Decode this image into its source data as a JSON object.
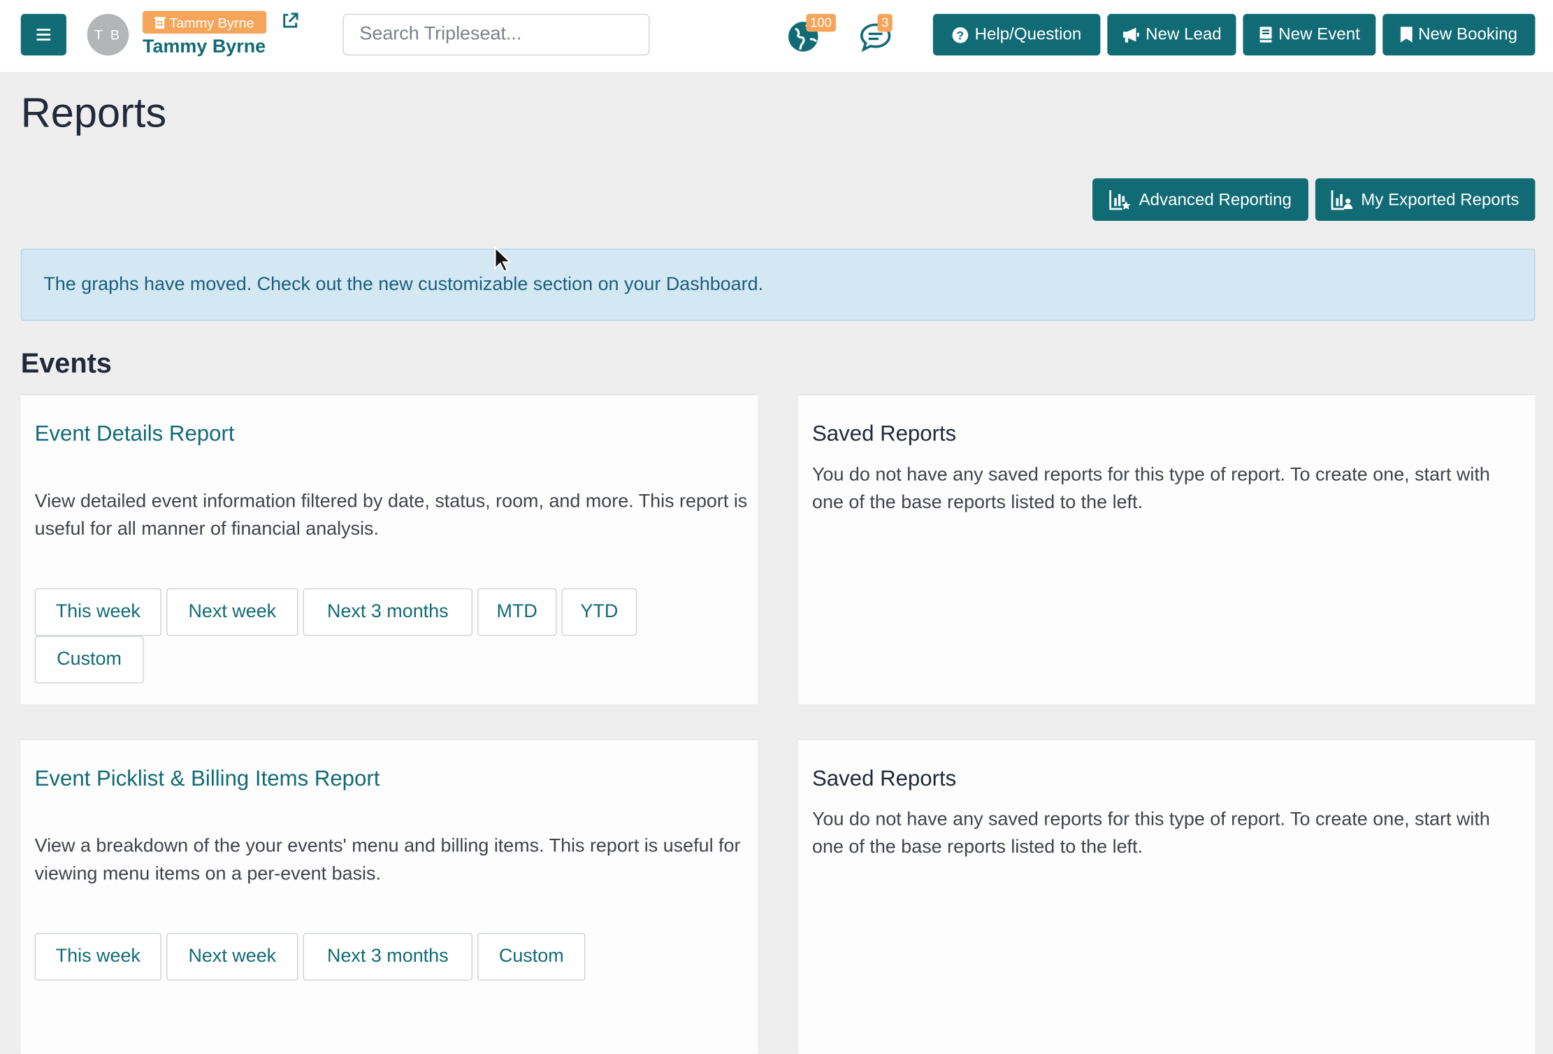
{
  "topbar": {
    "menu_icon": "hamburger-icon",
    "avatar_initials": "T B",
    "user_badge": "Tammy Byrne",
    "user_name": "Tammy Byrne",
    "search_placeholder": "Search Tripleseat...",
    "notifications_count": "100",
    "messages_count": "3",
    "buttons": {
      "help": "Help/Question",
      "new_lead": "New Lead",
      "new_event": "New Event",
      "new_booking": "New Booking"
    }
  },
  "page": {
    "title": "Reports",
    "advanced_reporting": "Advanced Reporting",
    "exported_reports": "My Exported Reports",
    "alert_text": "The graphs have moved. Check out the new customizable section on your Dashboard."
  },
  "events": {
    "section_title": "Events",
    "reports": [
      {
        "title": "Event Details Report",
        "description": "View detailed event information filtered by date, status, room, and more. This report is useful for all manner of financial analysis.",
        "ranges": [
          "This week",
          "Next week",
          "Next 3 months",
          "MTD",
          "YTD",
          "Custom"
        ],
        "saved_title": "Saved Reports",
        "saved_text": "You do not have any saved reports for this type of report. To create one, start with one of the base reports listed to the left."
      },
      {
        "title": "Event Picklist & Billing Items Report",
        "description": "View a breakdown of the your events' menu and billing items. This report is useful for viewing menu items on a per-event basis.",
        "ranges": [
          "This week",
          "Next week",
          "Next 3 months",
          "Custom"
        ],
        "saved_title": "Saved Reports",
        "saved_text": "You do not have any saved reports for this type of report. To create one, start with one of the base reports listed to the left."
      }
    ]
  },
  "colors": {
    "brand": "#116b75",
    "badge": "#f4a55a",
    "alert_bg": "#d3e8f3",
    "page_bg": "#edeeed"
  }
}
